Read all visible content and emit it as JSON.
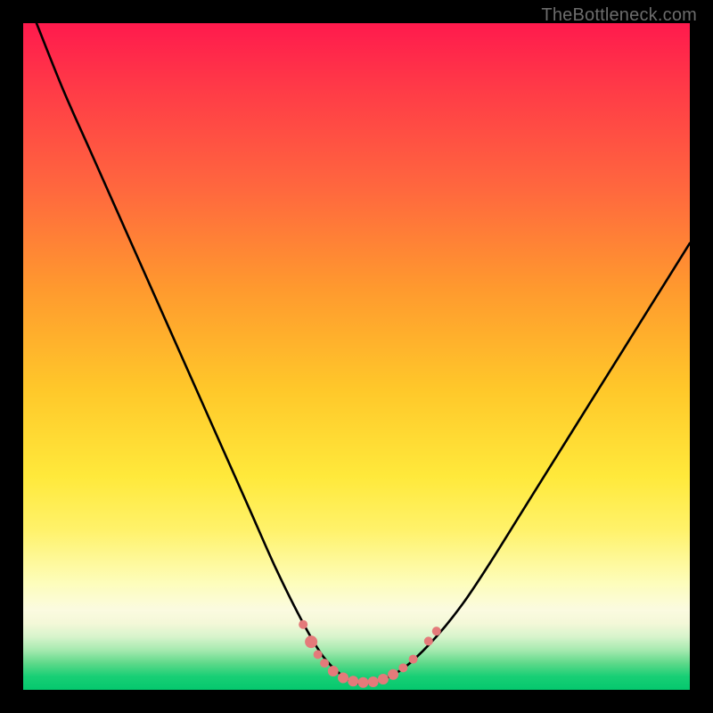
{
  "watermark": "TheBottleneck.com",
  "chart_data": {
    "type": "line",
    "title": "",
    "xlabel": "",
    "ylabel": "",
    "xlim": [
      0,
      100
    ],
    "ylim": [
      0,
      100
    ],
    "series": [
      {
        "name": "curve",
        "x": [
          2,
          6,
          10,
          14,
          18,
          22,
          26,
          30,
          34,
          38,
          42,
          45,
          48,
          50,
          52,
          55,
          58,
          62,
          66,
          70,
          75,
          80,
          85,
          90,
          95,
          100
        ],
        "values": [
          100,
          90,
          81,
          72,
          63,
          54,
          45,
          36,
          27,
          18,
          10,
          5,
          2,
          1,
          1,
          2,
          4,
          8,
          13,
          19,
          27,
          35,
          43,
          51,
          59,
          67
        ]
      }
    ],
    "markers": {
      "color": "#e47a7a",
      "points": [
        {
          "x": 42.0,
          "y": 9.8,
          "r": 5
        },
        {
          "x": 43.2,
          "y": 7.2,
          "r": 7
        },
        {
          "x": 44.2,
          "y": 5.3,
          "r": 5
        },
        {
          "x": 45.2,
          "y": 4.0,
          "r": 5
        },
        {
          "x": 46.5,
          "y": 2.8,
          "r": 6
        },
        {
          "x": 48.0,
          "y": 1.8,
          "r": 6
        },
        {
          "x": 49.5,
          "y": 1.3,
          "r": 6
        },
        {
          "x": 51.0,
          "y": 1.1,
          "r": 6
        },
        {
          "x": 52.5,
          "y": 1.2,
          "r": 6
        },
        {
          "x": 54.0,
          "y": 1.6,
          "r": 6
        },
        {
          "x": 55.5,
          "y": 2.3,
          "r": 6
        },
        {
          "x": 57.0,
          "y": 3.3,
          "r": 5
        },
        {
          "x": 58.5,
          "y": 4.6,
          "r": 5
        },
        {
          "x": 60.8,
          "y": 7.3,
          "r": 5
        },
        {
          "x": 62.0,
          "y": 8.8,
          "r": 5
        }
      ]
    },
    "colors": {
      "frame": "#000000",
      "curve": "#000000",
      "marker": "#e47a7a",
      "gradient_top": "#ff1a4d",
      "gradient_mid": "#ffe93b",
      "gradient_bottom": "#05c86e"
    }
  }
}
